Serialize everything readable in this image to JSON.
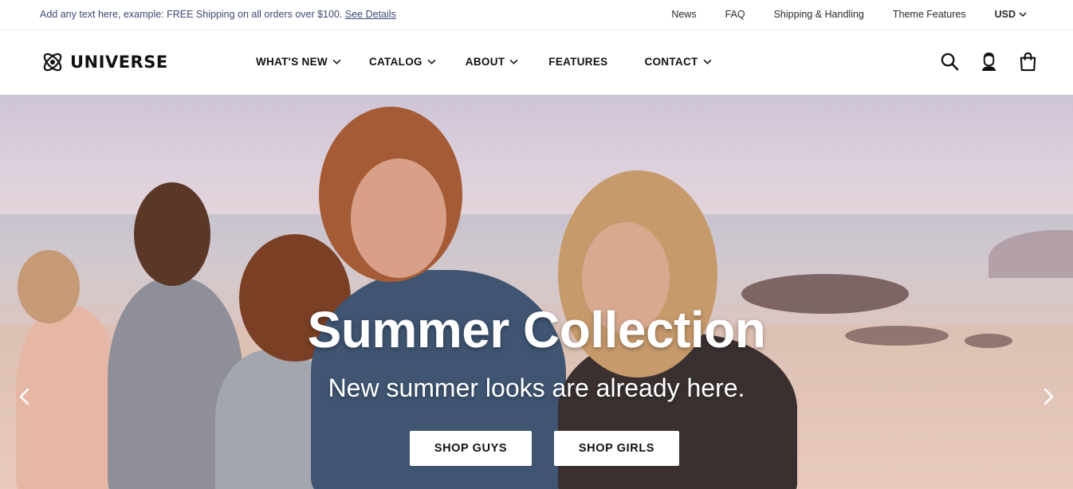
{
  "topbar": {
    "promo_text": "Add any text here, example: FREE Shipping on all orders over $100.",
    "promo_link": "See Details",
    "links": [
      "News",
      "FAQ",
      "Shipping & Handling",
      "Theme Features"
    ],
    "currency": "USD"
  },
  "header": {
    "logo_text": "UNIVERSE",
    "nav": [
      {
        "label": "WHAT'S NEW",
        "dropdown": true
      },
      {
        "label": "CATALOG",
        "dropdown": true
      },
      {
        "label": "ABOUT",
        "dropdown": true
      },
      {
        "label": "FEATURES",
        "dropdown": false
      },
      {
        "label": "CONTACT",
        "dropdown": true
      }
    ],
    "icons": [
      "search-icon",
      "account-icon",
      "cart-icon"
    ]
  },
  "hero": {
    "title": "Summer Collection",
    "subtitle": "New summer looks are already here.",
    "buttons": [
      "SHOP GUYS",
      "SHOP GIRLS"
    ]
  },
  "colors": {
    "promo_text": "#3d4a73",
    "accent": "#111111"
  }
}
